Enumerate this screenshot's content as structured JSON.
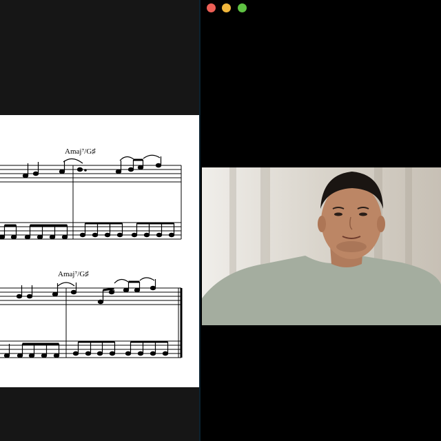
{
  "window": {
    "controls": [
      {
        "name": "close",
        "color": "#ec5f56"
      },
      {
        "name": "minimize",
        "color": "#f1b73c"
      },
      {
        "name": "maximize",
        "color": "#5fc243"
      }
    ]
  },
  "sheet_music": {
    "chord_symbol_1": "Amaj⁷/G♯",
    "chord_symbol_2": "Amaj⁷/G♯"
  },
  "video_tile": {
    "participant": "webcam-feed"
  }
}
